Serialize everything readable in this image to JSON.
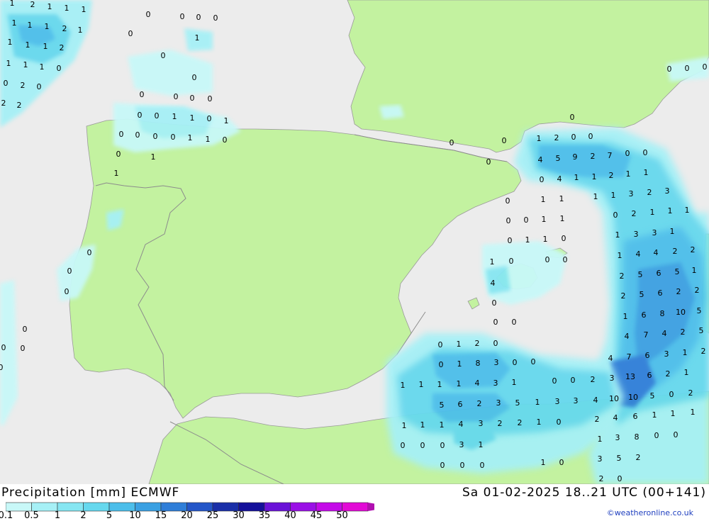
{
  "header": {
    "title_left": "Precipitation [mm] ECMWF",
    "title_right": "Sa 01-02-2025 18..21 UTC (00+141)"
  },
  "colors": {
    "sea": "#ececec",
    "land": "#c3f2a0",
    "border": "#8c8c8c",
    "precip_light": "#bff5f7",
    "precip_mid": "#8be8f3",
    "precip_high": "#55c8ee",
    "precip_heavy": "#3d9de6",
    "precip_extreme": "#2f6fd6"
  },
  "legend": {
    "ticks": [
      "0.1",
      "0.5",
      "1",
      "2",
      "5",
      "10",
      "15",
      "20",
      "25",
      "30",
      "35",
      "40",
      "45",
      "50"
    ],
    "colors": [
      "#c8f8f8",
      "#a6f0f6",
      "#86e6f2",
      "#66d8ee",
      "#4cbeea",
      "#3aa0e2",
      "#2f7ed8",
      "#2456c8",
      "#1a2fa8",
      "#14109a",
      "#6a12d8",
      "#9a10e6",
      "#c40ae8",
      "#e20ad6",
      "#b010b0"
    ]
  },
  "credit": "©weatheronline.co.uk",
  "labels": [
    [
      "1",
      17,
      5
    ],
    [
      "2",
      46,
      7
    ],
    [
      "1",
      70,
      10
    ],
    [
      "1",
      94,
      12
    ],
    [
      "1",
      118,
      14
    ],
    [
      "1",
      20,
      33
    ],
    [
      "1",
      42,
      36
    ],
    [
      "1",
      66,
      38
    ],
    [
      "2",
      91,
      41
    ],
    [
      "1",
      113,
      43
    ],
    [
      "1",
      14,
      60
    ],
    [
      "1",
      39,
      64
    ],
    [
      "1",
      64,
      66
    ],
    [
      "2",
      87,
      68
    ],
    [
      "1",
      12,
      90
    ],
    [
      "1",
      36,
      92
    ],
    [
      "1",
      59,
      95
    ],
    [
      "0",
      83,
      97
    ],
    [
      "0",
      8,
      118
    ],
    [
      "2",
      32,
      121
    ],
    [
      "0",
      55,
      123
    ],
    [
      "2",
      5,
      146
    ],
    [
      "2",
      27,
      149
    ],
    [
      "0",
      209,
      21
    ],
    [
      "0",
      257,
      24
    ],
    [
      "0",
      280,
      25
    ],
    [
      "0",
      304,
      26
    ],
    [
      "0",
      184,
      48
    ],
    [
      "1",
      278,
      54
    ],
    [
      "0",
      230,
      79
    ],
    [
      "0",
      274,
      110
    ],
    [
      "0",
      200,
      134
    ],
    [
      "0",
      248,
      137
    ],
    [
      "0",
      271,
      139
    ],
    [
      "0",
      296,
      140
    ],
    [
      "0",
      197,
      163
    ],
    [
      "0",
      221,
      164
    ],
    [
      "1",
      246,
      165
    ],
    [
      "1",
      271,
      167
    ],
    [
      "0",
      295,
      168
    ],
    [
      "1",
      319,
      171
    ],
    [
      "0",
      171,
      190
    ],
    [
      "0",
      194,
      191
    ],
    [
      "0",
      219,
      193
    ],
    [
      "0",
      244,
      194
    ],
    [
      "1",
      268,
      195
    ],
    [
      "1",
      293,
      197
    ],
    [
      "0",
      317,
      198
    ],
    [
      "0",
      167,
      218
    ],
    [
      "1",
      216,
      222
    ],
    [
      "1",
      164,
      245
    ],
    [
      "0",
      637,
      202
    ],
    [
      "0",
      711,
      199
    ],
    [
      "0",
      689,
      229
    ],
    [
      "0",
      807,
      166
    ],
    [
      "1",
      760,
      196
    ],
    [
      "2",
      785,
      195
    ],
    [
      "0",
      809,
      194
    ],
    [
      "0",
      833,
      193
    ],
    [
      "4",
      762,
      226
    ],
    [
      "5",
      787,
      224
    ],
    [
      "9",
      811,
      222
    ],
    [
      "2",
      836,
      221
    ],
    [
      "7",
      860,
      220
    ],
    [
      "0",
      885,
      217
    ],
    [
      "0",
      910,
      216
    ],
    [
      "0",
      764,
      254
    ],
    [
      "4",
      789,
      253
    ],
    [
      "1",
      813,
      251
    ],
    [
      "1",
      838,
      250
    ],
    [
      "2",
      862,
      248
    ],
    [
      "1",
      886,
      246
    ],
    [
      "1",
      911,
      244
    ],
    [
      "0",
      716,
      284
    ],
    [
      "1",
      766,
      282
    ],
    [
      "1",
      792,
      281
    ],
    [
      "1",
      840,
      278
    ],
    [
      "1",
      865,
      276
    ],
    [
      "3",
      890,
      274
    ],
    [
      "2",
      916,
      272
    ],
    [
      "3",
      941,
      270
    ],
    [
      "0",
      717,
      312
    ],
    [
      "0",
      742,
      311
    ],
    [
      "1",
      767,
      310
    ],
    [
      "1",
      793,
      309
    ],
    [
      "0",
      868,
      304
    ],
    [
      "2",
      894,
      302
    ],
    [
      "1",
      920,
      300
    ],
    [
      "1",
      945,
      298
    ],
    [
      "1",
      969,
      297
    ],
    [
      "0",
      719,
      340
    ],
    [
      "1",
      744,
      339
    ],
    [
      "1",
      769,
      338
    ],
    [
      "0",
      795,
      337
    ],
    [
      "1",
      871,
      332
    ],
    [
      "3",
      897,
      331
    ],
    [
      "3",
      923,
      329
    ],
    [
      "1",
      948,
      327
    ],
    [
      "1",
      694,
      370
    ],
    [
      "0",
      721,
      369
    ],
    [
      "0",
      772,
      367
    ],
    [
      "0",
      797,
      367
    ],
    [
      "1",
      874,
      361
    ],
    [
      "4",
      900,
      359
    ],
    [
      "4",
      925,
      357
    ],
    [
      "2",
      952,
      355
    ],
    [
      "2",
      977,
      353
    ],
    [
      "4",
      695,
      400
    ],
    [
      "2",
      877,
      390
    ],
    [
      "5",
      903,
      388
    ],
    [
      "6",
      929,
      386
    ],
    [
      "5",
      955,
      384
    ],
    [
      "1",
      979,
      382
    ],
    [
      "0",
      697,
      428
    ],
    [
      "2",
      879,
      418
    ],
    [
      "5",
      905,
      416
    ],
    [
      "6",
      931,
      414
    ],
    [
      "2",
      957,
      412
    ],
    [
      "2",
      983,
      410
    ],
    [
      "0",
      699,
      455
    ],
    [
      "0",
      725,
      455
    ],
    [
      "1",
      882,
      447
    ],
    [
      "6",
      908,
      445
    ],
    [
      "8",
      934,
      443
    ],
    [
      "10",
      960,
      441
    ],
    [
      "5",
      986,
      439
    ],
    [
      "4",
      884,
      475
    ],
    [
      "7",
      911,
      473
    ],
    [
      "4",
      937,
      471
    ],
    [
      "2",
      963,
      469
    ],
    [
      "5",
      989,
      467
    ],
    [
      "0",
      621,
      487
    ],
    [
      "1",
      647,
      486
    ],
    [
      "2",
      673,
      485
    ],
    [
      "0",
      699,
      485
    ],
    [
      "4",
      861,
      506
    ],
    [
      "7",
      887,
      504
    ],
    [
      "6",
      913,
      502
    ],
    [
      "3",
      940,
      500
    ],
    [
      "1",
      966,
      498
    ],
    [
      "2",
      992,
      496
    ],
    [
      "0",
      622,
      515
    ],
    [
      "1",
      648,
      514
    ],
    [
      "8",
      674,
      513
    ],
    [
      "3",
      700,
      512
    ],
    [
      "0",
      726,
      512
    ],
    [
      "0",
      752,
      511
    ],
    [
      "3",
      863,
      534
    ],
    [
      "13",
      889,
      532
    ],
    [
      "6",
      916,
      530
    ],
    [
      "2",
      942,
      528
    ],
    [
      "1",
      968,
      526
    ],
    [
      "1",
      568,
      544
    ],
    [
      "1",
      594,
      543
    ],
    [
      "1",
      620,
      543
    ],
    [
      "1",
      647,
      542
    ],
    [
      "4",
      673,
      541
    ],
    [
      "3",
      699,
      541
    ],
    [
      "1",
      725,
      540
    ],
    [
      "0",
      782,
      538
    ],
    [
      "0",
      808,
      537
    ],
    [
      "2",
      836,
      536
    ],
    [
      "5",
      623,
      572
    ],
    [
      "6",
      649,
      571
    ],
    [
      "2",
      676,
      570
    ],
    [
      "3",
      703,
      569
    ],
    [
      "5",
      730,
      569
    ],
    [
      "1",
      758,
      568
    ],
    [
      "3",
      786,
      567
    ],
    [
      "3",
      812,
      566
    ],
    [
      "4",
      840,
      565
    ],
    [
      "10",
      866,
      563
    ],
    [
      "10",
      893,
      561
    ],
    [
      "5",
      920,
      559
    ],
    [
      "0",
      947,
      557
    ],
    [
      "2",
      974,
      555
    ],
    [
      "1",
      570,
      601
    ],
    [
      "1",
      596,
      600
    ],
    [
      "1",
      623,
      600
    ],
    [
      "4",
      650,
      599
    ],
    [
      "3",
      678,
      598
    ],
    [
      "2",
      705,
      598
    ],
    [
      "2",
      733,
      597
    ],
    [
      "1",
      760,
      596
    ],
    [
      "0",
      788,
      596
    ],
    [
      "2",
      842,
      592
    ],
    [
      "4",
      868,
      590
    ],
    [
      "6",
      896,
      588
    ],
    [
      "1",
      923,
      586
    ],
    [
      "1",
      949,
      584
    ],
    [
      "1",
      977,
      582
    ],
    [
      "0",
      568,
      629
    ],
    [
      "0",
      596,
      629
    ],
    [
      "0",
      624,
      629
    ],
    [
      "3",
      651,
      628
    ],
    [
      "1",
      678,
      628
    ],
    [
      "1",
      846,
      620
    ],
    [
      "3",
      871,
      618
    ],
    [
      "8",
      898,
      617
    ],
    [
      "0",
      926,
      615
    ],
    [
      "0",
      953,
      614
    ],
    [
      "0",
      624,
      657
    ],
    [
      "0",
      652,
      657
    ],
    [
      "0",
      680,
      657
    ],
    [
      "1",
      766,
      653
    ],
    [
      "0",
      792,
      653
    ],
    [
      "3",
      846,
      648
    ],
    [
      "5",
      873,
      647
    ],
    [
      "2",
      900,
      646
    ],
    [
      "2",
      848,
      676
    ],
    [
      "0",
      874,
      676
    ],
    [
      "0",
      944,
      98
    ],
    [
      "0",
      969,
      97
    ],
    [
      "0",
      994,
      95
    ],
    [
      "0",
      126,
      357
    ],
    [
      "0",
      98,
      383
    ],
    [
      "0",
      94,
      412
    ],
    [
      "0",
      35,
      465
    ],
    [
      "0",
      5,
      491
    ],
    [
      "0",
      32,
      492
    ],
    [
      "0",
      1,
      519
    ]
  ]
}
